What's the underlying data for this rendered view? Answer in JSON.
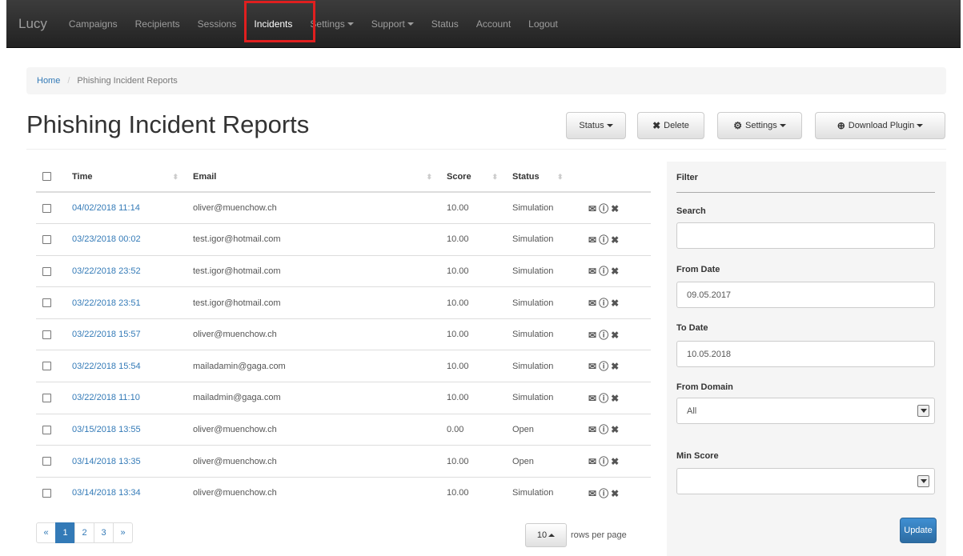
{
  "nav": {
    "brand": "Lucy",
    "items": [
      {
        "label": "Campaigns",
        "dropdown": false
      },
      {
        "label": "Recipients",
        "dropdown": false
      },
      {
        "label": "Sessions",
        "dropdown": false
      },
      {
        "label": "Incidents",
        "dropdown": false,
        "active": true
      },
      {
        "label": "Settings",
        "dropdown": true
      },
      {
        "label": "Support",
        "dropdown": true
      },
      {
        "label": "Status",
        "dropdown": false
      },
      {
        "label": "Account",
        "dropdown": false
      },
      {
        "label": "Logout",
        "dropdown": false
      }
    ]
  },
  "breadcrumb": {
    "home": "Home",
    "separator": "/",
    "current": "Phishing Incident Reports"
  },
  "page": {
    "title": "Phishing Incident Reports"
  },
  "toolbar": {
    "status_label": "Status",
    "delete_label": "Delete",
    "settings_label": "Settings",
    "download_label": "Download Plugin"
  },
  "table": {
    "headers": {
      "time": "Time",
      "email": "Email",
      "score": "Score",
      "status": "Status"
    },
    "rows": [
      {
        "time": "04/02/2018 11:14",
        "email": "oliver@muenchow.ch",
        "score": "10.00",
        "status": "Simulation"
      },
      {
        "time": "03/23/2018 00:02",
        "email": "test.igor@hotmail.com",
        "score": "10.00",
        "status": "Simulation"
      },
      {
        "time": "03/22/2018 23:52",
        "email": "test.igor@hotmail.com",
        "score": "10.00",
        "status": "Simulation"
      },
      {
        "time": "03/22/2018 23:51",
        "email": "test.igor@hotmail.com",
        "score": "10.00",
        "status": "Simulation"
      },
      {
        "time": "03/22/2018 15:57",
        "email": "oliver@muenchow.ch",
        "score": "10.00",
        "status": "Simulation"
      },
      {
        "time": "03/22/2018 15:54",
        "email": "mailadamin@gaga.com",
        "score": "10.00",
        "status": "Simulation"
      },
      {
        "time": "03/22/2018 11:10",
        "email": "mailadmin@gaga.com",
        "score": "10.00",
        "status": "Simulation"
      },
      {
        "time": "03/15/2018 13:55",
        "email": "oliver@muenchow.ch",
        "score": "0.00",
        "status": "Open"
      },
      {
        "time": "03/14/2018 13:35",
        "email": "oliver@muenchow.ch",
        "score": "10.00",
        "status": "Open"
      },
      {
        "time": "03/14/2018 13:34",
        "email": "oliver@muenchow.ch",
        "score": "10.00",
        "status": "Simulation"
      }
    ]
  },
  "filter": {
    "title": "Filter",
    "search_label": "Search",
    "search_value": "",
    "from_date_label": "From Date",
    "from_date_value": "09.05.2017",
    "to_date_label": "To Date",
    "to_date_value": "10.05.2018",
    "from_domain_label": "From Domain",
    "from_domain_value": "All",
    "min_score_label": "Min Score",
    "min_score_value": "",
    "update_label": "Update"
  },
  "pagination": {
    "prev": "«",
    "pages": [
      "1",
      "2",
      "3"
    ],
    "active_page": "1",
    "next": "»",
    "rows_per_page_value": "10",
    "rows_per_page_label": "rows per page"
  },
  "colors": {
    "accent": "#337ab7",
    "navbar": "#222222",
    "highlight": "#e01f1f"
  }
}
